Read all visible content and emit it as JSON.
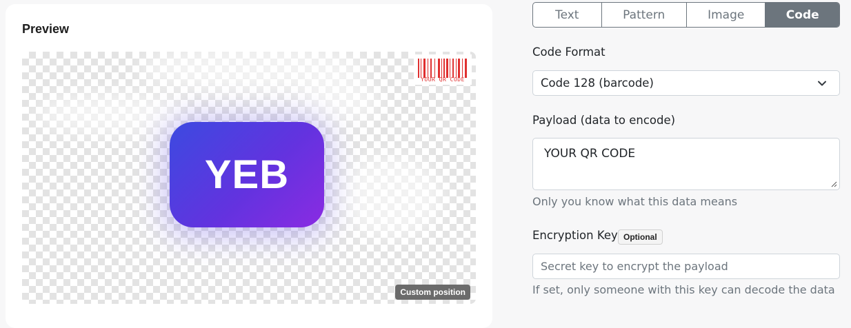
{
  "preview": {
    "title": "Preview",
    "logo_text": "YEB",
    "barcode_caption": "YOUR QR CODE",
    "custom_position_label": "Custom position"
  },
  "tabs": [
    {
      "label": "Text",
      "active": false
    },
    {
      "label": "Pattern",
      "active": false
    },
    {
      "label": "Image",
      "active": false
    },
    {
      "label": "Code",
      "active": true
    }
  ],
  "form": {
    "code_format": {
      "label": "Code Format",
      "value": "Code 128 (barcode)"
    },
    "payload": {
      "label": "Payload (data to encode)",
      "value": "YOUR QR CODE",
      "hint": "Only you know what this data means"
    },
    "encryption_key": {
      "label": "Encryption Key",
      "badge": "Optional",
      "placeholder": "Secret key to encrypt the payload",
      "hint": "If set, only someone with this key can decode the data"
    }
  },
  "icons": {
    "select_chevron": "chevron-down-icon",
    "resize_grip": "resize-grip-icon",
    "barcode": "barcode-icon"
  },
  "colors": {
    "tab_active_bg": "#6c757d",
    "logo_gradient_start": "#3c4ae0",
    "logo_gradient_end": "#8a2be2",
    "barcode_color": "#e03030"
  }
}
